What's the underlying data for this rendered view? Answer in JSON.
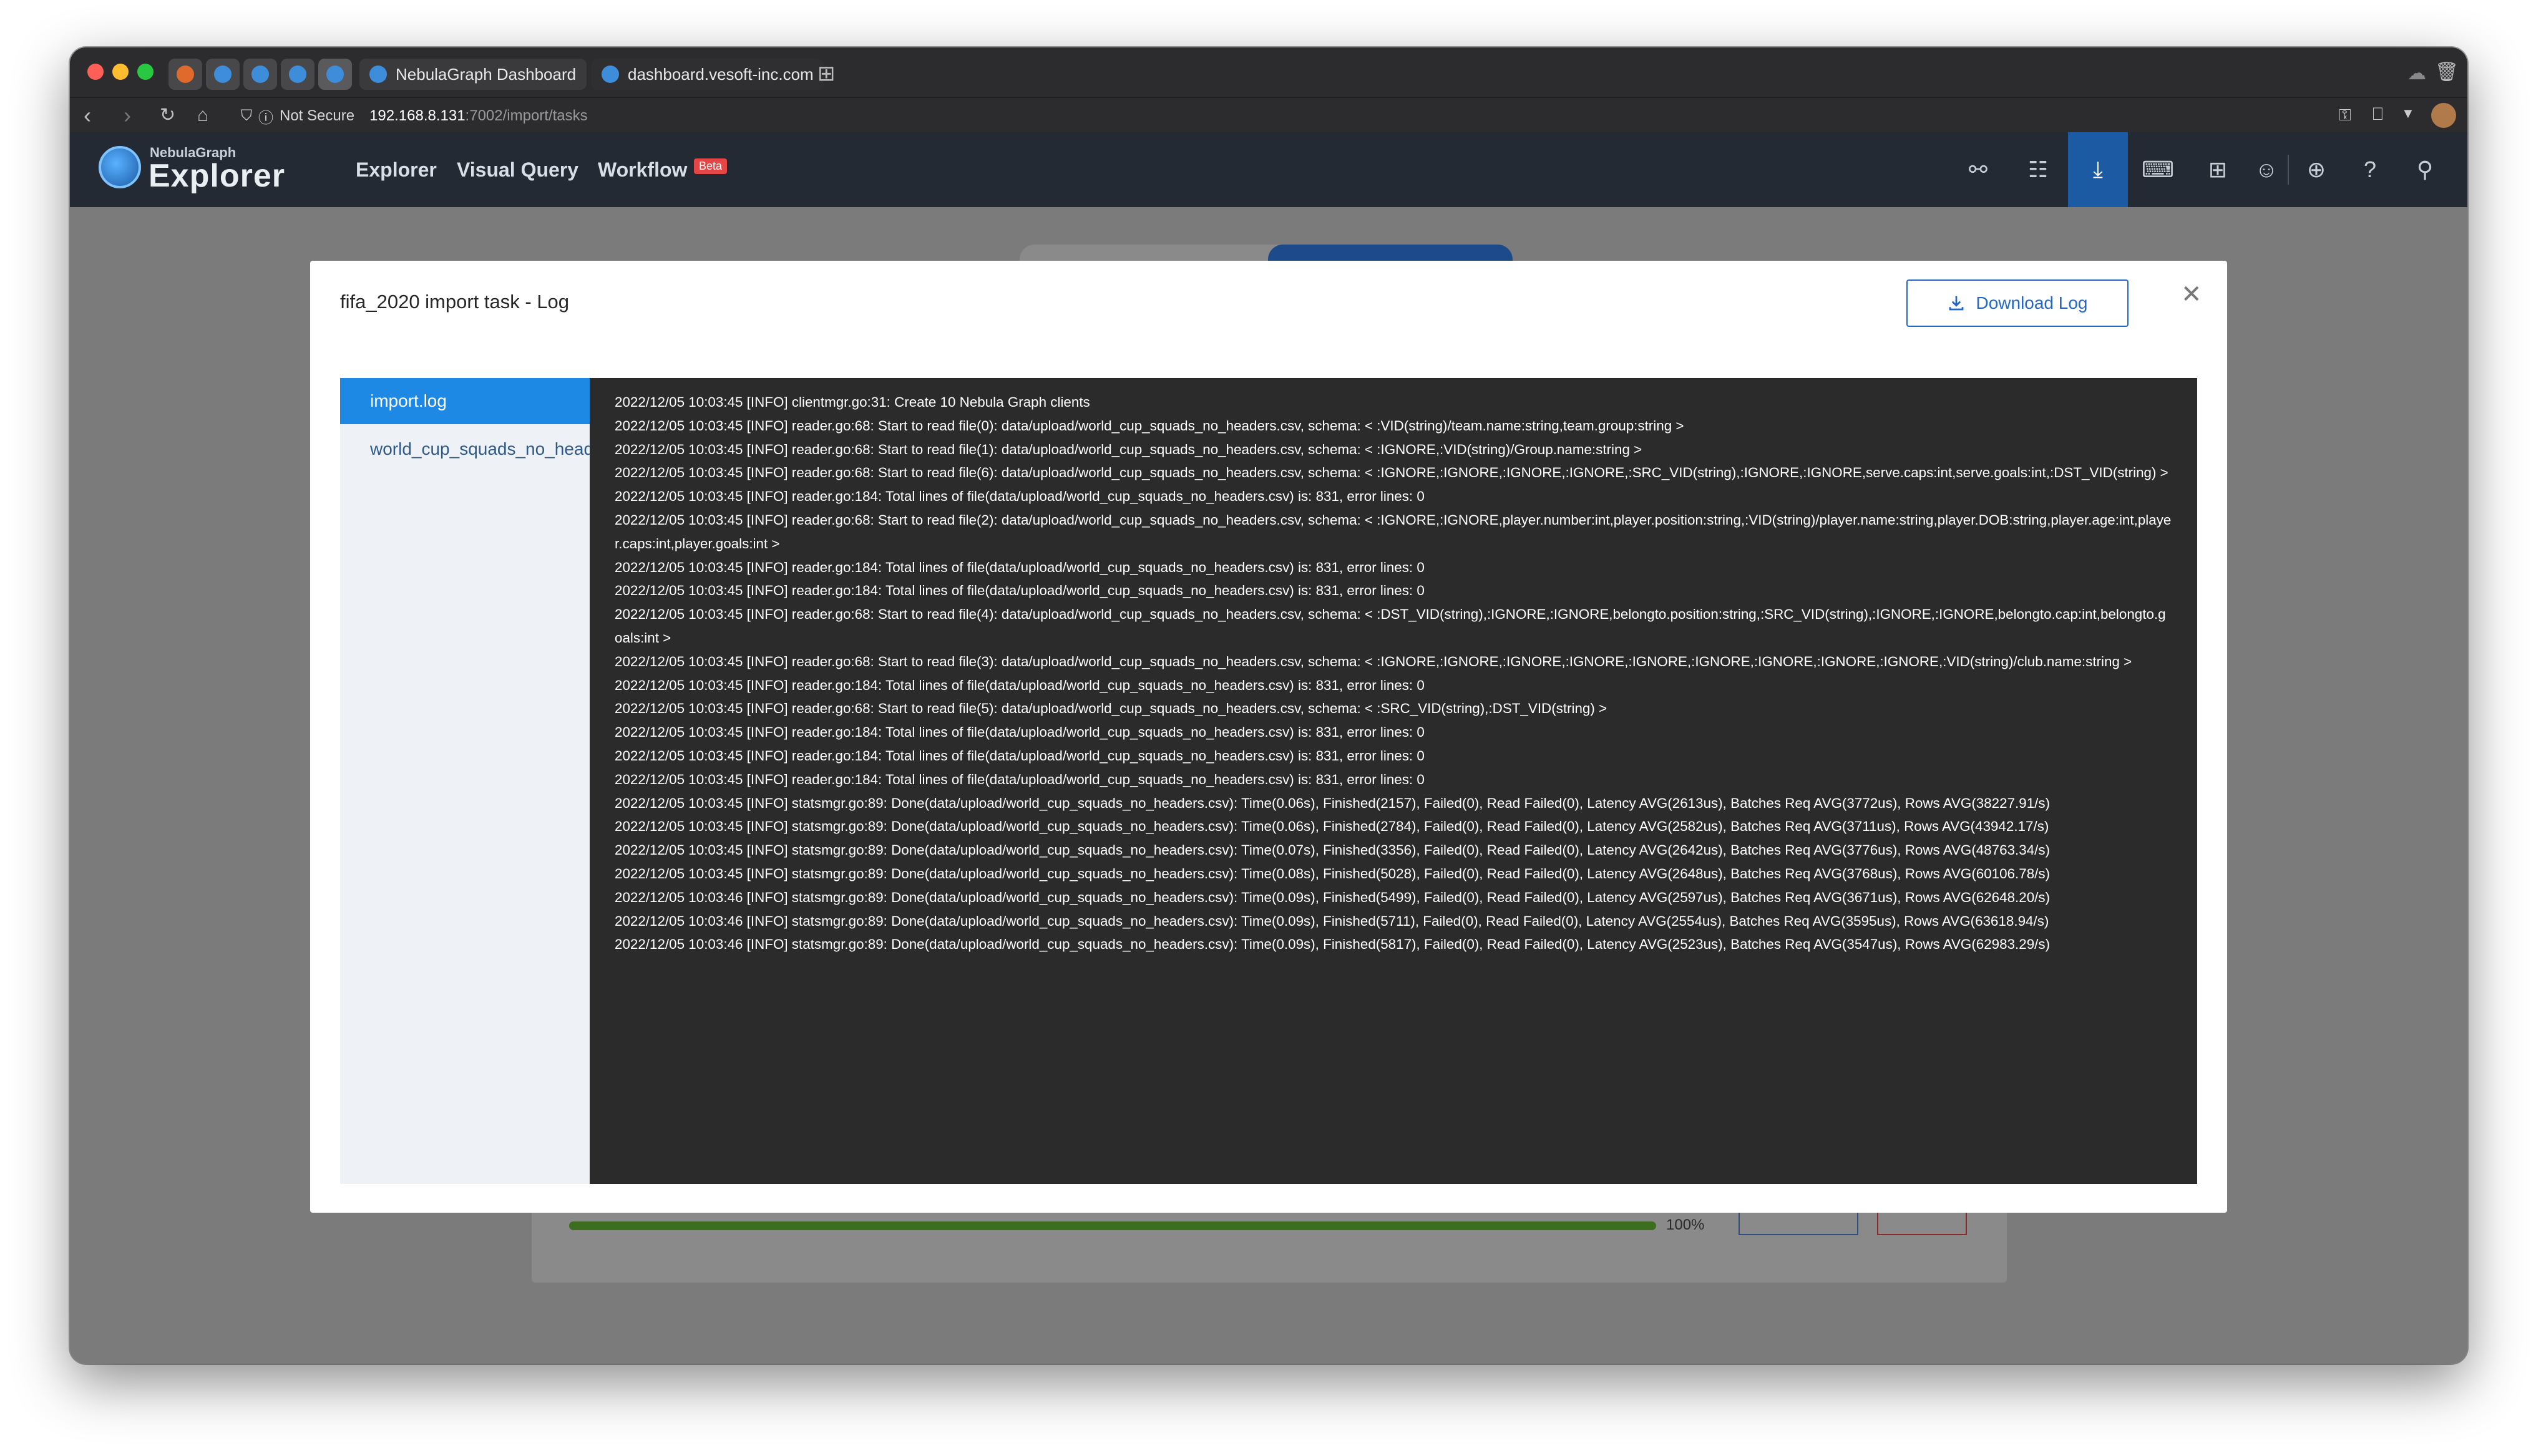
{
  "browser": {
    "tabs": [
      {
        "title": "NebulaGraph Dashboard"
      },
      {
        "title": "dashboard.vesoft-inc.com"
      }
    ],
    "security_label": "Not Secure",
    "url_host": "192.168.8.131",
    "url_path": ":7002/import/tasks"
  },
  "app_header": {
    "brand_top": "NebulaGraph",
    "brand": "Explorer",
    "menu": [
      "Explorer",
      "Visual Query",
      "Workflow"
    ],
    "beta_badge": "Beta"
  },
  "background_task": {
    "progress_percent": 100,
    "progress_label": "100%"
  },
  "modal": {
    "title": "fifa_2020 import task - Log",
    "download_button": "Download Log",
    "files": [
      {
        "name": "import.log",
        "active": true
      },
      {
        "name": "world_cup_squads_no_headersFail.csv",
        "active": false
      }
    ],
    "log_lines": [
      "2022/12/05 10:03:45 [INFO] clientmgr.go:31: Create 10 Nebula Graph clients",
      "2022/12/05 10:03:45 [INFO] reader.go:68: Start to read file(0): data/upload/world_cup_squads_no_headers.csv, schema: < :VID(string)/team.name:string,team.group:string >",
      "2022/12/05 10:03:45 [INFO] reader.go:68: Start to read file(1): data/upload/world_cup_squads_no_headers.csv, schema: < :IGNORE,:VID(string)/Group.name:string >",
      "2022/12/05 10:03:45 [INFO] reader.go:68: Start to read file(6): data/upload/world_cup_squads_no_headers.csv, schema: < :IGNORE,:IGNORE,:IGNORE,:IGNORE,:SRC_VID(string),:IGNORE,:IGNORE,serve.caps:int,serve.goals:int,:DST_VID(string) >",
      "2022/12/05 10:03:45 [INFO] reader.go:184: Total lines of file(data/upload/world_cup_squads_no_headers.csv) is: 831, error lines: 0",
      "2022/12/05 10:03:45 [INFO] reader.go:68: Start to read file(2): data/upload/world_cup_squads_no_headers.csv, schema: < :IGNORE,:IGNORE,player.number:int,player.position:string,:VID(string)/player.name:string,player.DOB:string,player.age:int,player.caps:int,player.goals:int >",
      "2022/12/05 10:03:45 [INFO] reader.go:184: Total lines of file(data/upload/world_cup_squads_no_headers.csv) is: 831, error lines: 0",
      "2022/12/05 10:03:45 [INFO] reader.go:184: Total lines of file(data/upload/world_cup_squads_no_headers.csv) is: 831, error lines: 0",
      "2022/12/05 10:03:45 [INFO] reader.go:68: Start to read file(4): data/upload/world_cup_squads_no_headers.csv, schema: < :DST_VID(string),:IGNORE,:IGNORE,belongto.position:string,:SRC_VID(string),:IGNORE,:IGNORE,belongto.cap:int,belongto.goals:int >",
      "2022/12/05 10:03:45 [INFO] reader.go:68: Start to read file(3): data/upload/world_cup_squads_no_headers.csv, schema: < :IGNORE,:IGNORE,:IGNORE,:IGNORE,:IGNORE,:IGNORE,:IGNORE,:IGNORE,:IGNORE,:VID(string)/club.name:string >",
      "2022/12/05 10:03:45 [INFO] reader.go:184: Total lines of file(data/upload/world_cup_squads_no_headers.csv) is: 831, error lines: 0",
      "2022/12/05 10:03:45 [INFO] reader.go:68: Start to read file(5): data/upload/world_cup_squads_no_headers.csv, schema: < :SRC_VID(string),:DST_VID(string) >",
      "2022/12/05 10:03:45 [INFO] reader.go:184: Total lines of file(data/upload/world_cup_squads_no_headers.csv) is: 831, error lines: 0",
      "2022/12/05 10:03:45 [INFO] reader.go:184: Total lines of file(data/upload/world_cup_squads_no_headers.csv) is: 831, error lines: 0",
      "2022/12/05 10:03:45 [INFO] reader.go:184: Total lines of file(data/upload/world_cup_squads_no_headers.csv) is: 831, error lines: 0",
      "2022/12/05 10:03:45 [INFO] statsmgr.go:89: Done(data/upload/world_cup_squads_no_headers.csv): Time(0.06s), Finished(2157), Failed(0), Read Failed(0), Latency AVG(2613us), Batches Req AVG(3772us), Rows AVG(38227.91/s)",
      "2022/12/05 10:03:45 [INFO] statsmgr.go:89: Done(data/upload/world_cup_squads_no_headers.csv): Time(0.06s), Finished(2784), Failed(0), Read Failed(0), Latency AVG(2582us), Batches Req AVG(3711us), Rows AVG(43942.17/s)",
      "2022/12/05 10:03:45 [INFO] statsmgr.go:89: Done(data/upload/world_cup_squads_no_headers.csv): Time(0.07s), Finished(3356), Failed(0), Read Failed(0), Latency AVG(2642us), Batches Req AVG(3776us), Rows AVG(48763.34/s)",
      "2022/12/05 10:03:45 [INFO] statsmgr.go:89: Done(data/upload/world_cup_squads_no_headers.csv): Time(0.08s), Finished(5028), Failed(0), Read Failed(0), Latency AVG(2648us), Batches Req AVG(3768us), Rows AVG(60106.78/s)",
      "2022/12/05 10:03:46 [INFO] statsmgr.go:89: Done(data/upload/world_cup_squads_no_headers.csv): Time(0.09s), Finished(5499), Failed(0), Read Failed(0), Latency AVG(2597us), Batches Req AVG(3671us), Rows AVG(62648.20/s)",
      "2022/12/05 10:03:46 [INFO] statsmgr.go:89: Done(data/upload/world_cup_squads_no_headers.csv): Time(0.09s), Finished(5711), Failed(0), Read Failed(0), Latency AVG(2554us), Batches Req AVG(3595us), Rows AVG(63618.94/s)",
      "2022/12/05 10:03:46 [INFO] statsmgr.go:89: Done(data/upload/world_cup_squads_no_headers.csv): Time(0.09s), Finished(5817), Failed(0), Read Failed(0), Latency AVG(2523us), Batches Req AVG(3547us), Rows AVG(62983.29/s)"
    ]
  },
  "icons": [
    "graph-icon",
    "tree-icon",
    "import-icon",
    "console-icon",
    "schema-icon",
    "user-icon",
    "globe-icon",
    "help-icon",
    "connection-icon"
  ],
  "colors": {
    "accent": "#1e88e5",
    "header_bg": "#232a33",
    "log_bg": "#2b2b2b",
    "progress": "#3d6d1f"
  }
}
